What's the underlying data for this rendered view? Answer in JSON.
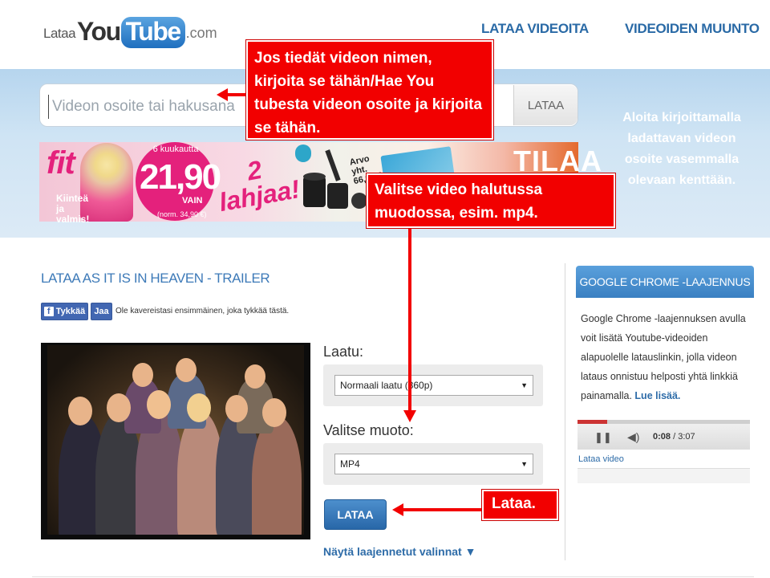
{
  "header": {
    "logo": {
      "part1": "Lataa",
      "part2": "You",
      "part3": "Tube",
      "part4": ".com"
    },
    "nav": [
      "LATAA VIDEOITA",
      "VIDEOIDEN MUUNTO"
    ]
  },
  "search": {
    "placeholder": "Videon osoite tai hakusana",
    "button": "LATAA",
    "hint": "Aloita kirjoittamalla ladattavan videon osoite vasemmalla olevaan kenttään."
  },
  "ad": {
    "brand": "fit",
    "kiintea": "Kiinteä ja valmis!",
    "months": "6 kuukautta",
    "price": "21,90",
    "vain": "VAIN",
    "norm": "(norm. 34,90 €)",
    "gift": "2 lahjaa!",
    "value": "Arvo yht. 66,90 €",
    "cta": "TILAA"
  },
  "video": {
    "title": "LATAA AS IT IS IN HEAVEN - TRAILER",
    "fb_like": "Tykkää",
    "fb_share": "Jaa",
    "fb_text": "Ole kavereistasi ensimmäinen, joka tykkää tästä."
  },
  "options": {
    "quality_label": "Laatu:",
    "quality_value": "Normaali laatu (360p)",
    "format_label": "Valitse muoto:",
    "format_value": "MP4",
    "download": "LATAA",
    "advanced": "Näytä laajennetut valinnat ▼"
  },
  "sidebar": {
    "title": "GOOGLE CHROME -LAAJENNUS",
    "text": "Google Chrome -laajennuksen avulla voit lisätä Youtube-videoiden alapuolelle latauslinkin, jolla videon lataus onnistuu helposti yhtä linkkiä painamalla.",
    "more": "Lue lisää.",
    "player_time": "0:08",
    "player_total": "3:07",
    "player_link": "Lataa video",
    "player_progress": 0.17
  },
  "callouts": {
    "search": "Jos tiedät videon nimen, kirjoita se tähän/Hae You tubesta videon osoite ja kirjoita se tähän.",
    "format": "Valitse video halutussa muodossa, esim. mp4.",
    "download": "Lataa."
  },
  "colors": {
    "callout": "#f20000",
    "accent": "#2e6ca8",
    "button": "#3677b8"
  }
}
